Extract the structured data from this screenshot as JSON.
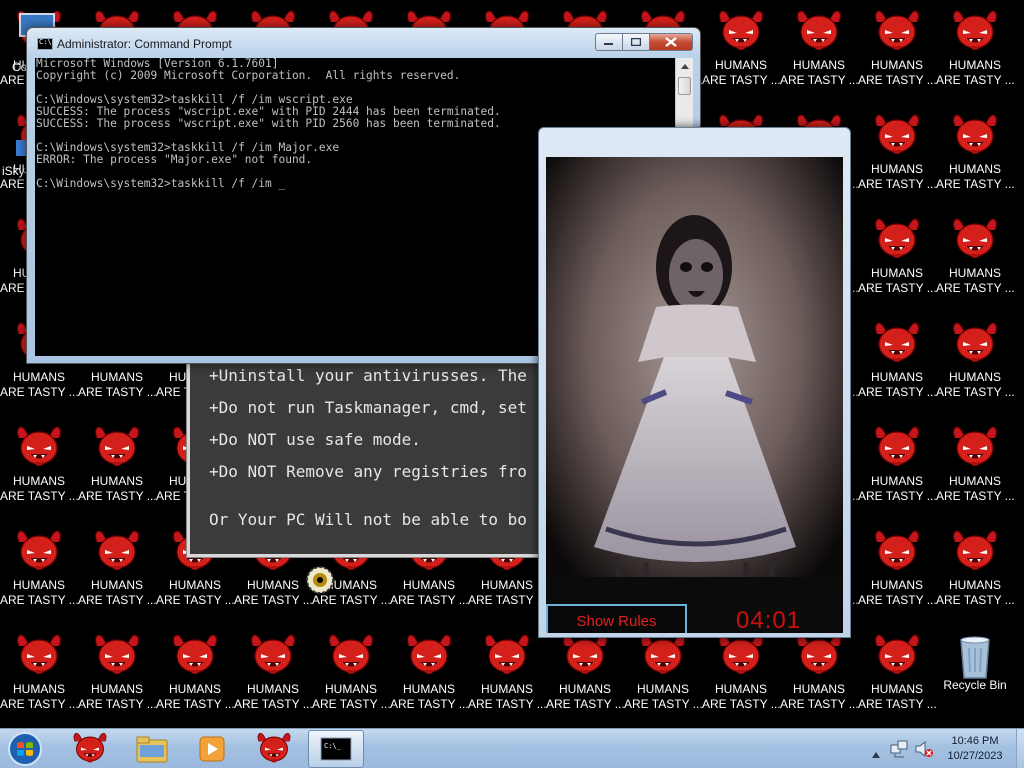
{
  "desktop": {
    "icon_label_line1": "HUMANS",
    "icon_label_line2": "ARE TASTY ...",
    "recycle_bin": "Recycle Bin",
    "edge_labels": [
      "Co",
      "iSky"
    ]
  },
  "cmd": {
    "title": "Administrator: Command Prompt",
    "lines": [
      "Microsoft Windows [Version 6.1.7601]",
      "Copyright (c) 2009 Microsoft Corporation.  All rights reserved.",
      "",
      "C:\\Windows\\system32>taskkill /f /im wscript.exe",
      "SUCCESS: The process \"wscript.exe\" with PID 2444 has been terminated.",
      "SUCCESS: The process \"wscript.exe\" with PID 2560 has been terminated.",
      "",
      "C:\\Windows\\system32>taskkill /f /im Major.exe",
      "ERROR: The process \"Major.exe\" not found.",
      "",
      "C:\\Windows\\system32>taskkill /f /im _"
    ]
  },
  "rules": {
    "lines": [
      "+Uninstall your antivirusses. The",
      "+Do not run Taskmanager, cmd, set",
      "+Do NOT use safe mode.",
      "+Do NOT Remove any registries fro",
      "",
      "Or Your PC Will not be able to bo"
    ]
  },
  "video": {
    "show_rules_label": "Show Rules",
    "timer": "04:01"
  },
  "taskbar": {
    "time": "10:46 PM",
    "date": "10/27/2023"
  },
  "colors": {
    "devil_red": "#d4201a",
    "timer_red": "#cc1010",
    "console_text": "#c0c0c0"
  }
}
